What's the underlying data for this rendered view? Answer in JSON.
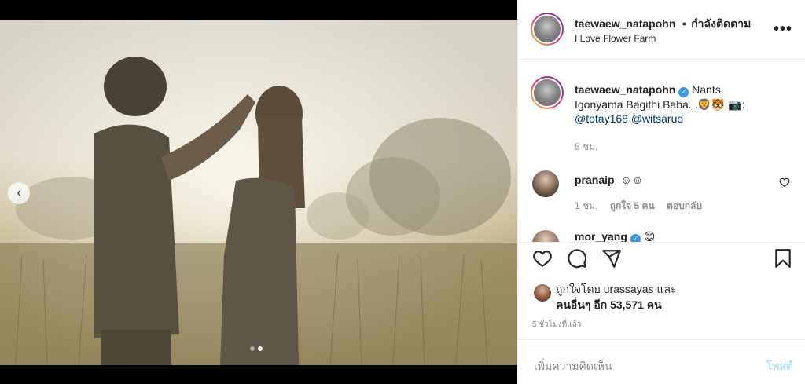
{
  "post": {
    "slide_count": 2,
    "active_slide": 2
  },
  "header": {
    "username": "taewaew_natapohn",
    "separator": "•",
    "follow_status": "กำลังติดตาม",
    "location": "I Love Flower Farm",
    "more_icon": "more-horizontal-icon"
  },
  "caption": {
    "username": "taewaew_natapohn",
    "verified": true,
    "text_line1": "Nants",
    "text_line2": "Igonyama Bagithi Baba...🦁🐯 📷:",
    "mention1": "@totay168",
    "mention2": "@witsarud",
    "time": "5 ชม."
  },
  "comments": [
    {
      "username": "pranaip",
      "text": "☺☺",
      "time": "1 ชม.",
      "likes": "ถูกใจ 5 คน",
      "reply": "ตอบกลับ"
    },
    {
      "username": "mor_yang",
      "text": "😊"
    }
  ],
  "actions": {
    "like_icon": "heart-icon",
    "comment_icon": "comment-icon",
    "share_icon": "send-icon",
    "save_icon": "bookmark-icon"
  },
  "likes": {
    "line1": "ถูกใจโดย urassayas และ",
    "line2": "คนอื่นๆ อีก 53,571 คน"
  },
  "time_ago": "5 ชั่วโมงที่แล้ว",
  "comment_box": {
    "placeholder": "เพิ่มความคิดเห็น",
    "post_label": "โพสต์"
  },
  "colors": {
    "link": "#00376b",
    "verified": "#3897f0",
    "post_button": "#b2dffc"
  }
}
